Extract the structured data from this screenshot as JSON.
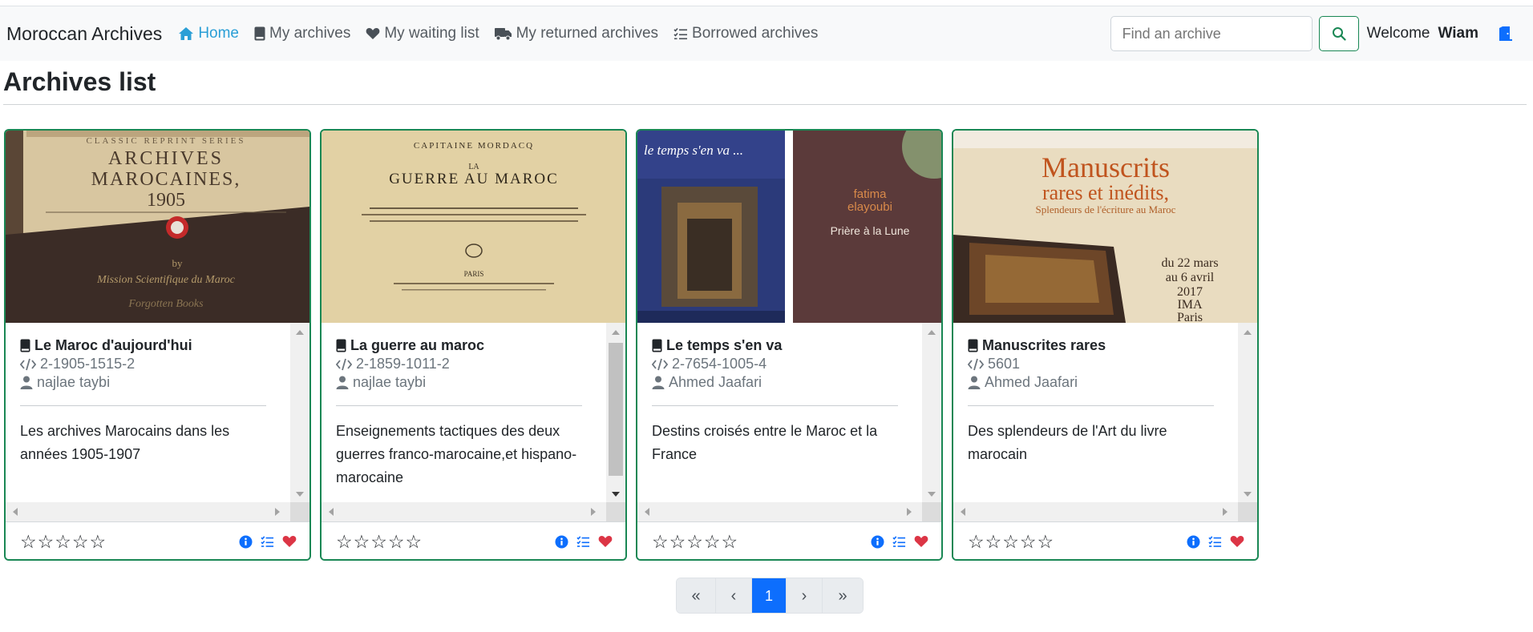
{
  "navbar": {
    "brand": "Moroccan Archives",
    "links": [
      {
        "label": "Home",
        "icon": "home-icon",
        "active": true
      },
      {
        "label": "My archives",
        "icon": "book-icon"
      },
      {
        "label": "My waiting list",
        "icon": "heart-icon"
      },
      {
        "label": "My returned archives",
        "icon": "truck-icon"
      },
      {
        "label": "Borrowed archives",
        "icon": "checklist-icon"
      }
    ],
    "search_placeholder": "Find an archive",
    "welcome": "Welcome",
    "username": "Wiam"
  },
  "page": {
    "title": "Archives list"
  },
  "cards": [
    {
      "title": "Le Maroc d'aujourd'hui",
      "code": "2-1905-1515-2",
      "author": "najlae taybi",
      "description": "Les archives Marocains dans les années 1905-1907",
      "cover_text": [
        "CLASSIC REPRINT SERIES",
        "ARCHIVES",
        "MAROCAINES,",
        "1905",
        "by",
        "Mission Scientifique du Maroc",
        "Forgotten Books"
      ],
      "rating": 0
    },
    {
      "title": "La guerre au maroc",
      "code": "2-1859-1011-2",
      "author": "najlae taybi",
      "description": "Enseignements tactiques des deux guerres franco-marocaine,et hispano-marocaine",
      "cover_text": [
        "CAPITAINE MORDACQ",
        "LA",
        "GUERRE AU MAROC",
        "PARIS"
      ],
      "rating": 0
    },
    {
      "title": "Le temps s'en va",
      "code": "2-7654-1005-4",
      "author": "Ahmed Jaafari",
      "description": "Destins croisés entre le Maroc et la France",
      "cover_text": [
        "le temps s'en va ...",
        "fatima",
        "elayoubi",
        "Prière à la Lune"
      ],
      "rating": 0
    },
    {
      "title": "Manuscrites rares",
      "code": "5601",
      "author": "Ahmed Jaafari",
      "description": "Des splendeurs de l'Art du livre marocain",
      "cover_text": [
        "Manuscrits",
        "rares et inédits,",
        "Splendeurs de l'écriture au Maroc",
        "du 22 mars",
        "au 6 avril",
        "2017",
        "IMA",
        "Paris"
      ],
      "rating": 0
    }
  ],
  "pagination": {
    "first": "«",
    "prev": "‹",
    "current": "1",
    "next": "›",
    "last": "»"
  },
  "colors": {
    "accent_green": "#198754",
    "active_blue": "#0d6efd",
    "home_link": "#2a9fd6",
    "heart_red": "#dc3545"
  }
}
